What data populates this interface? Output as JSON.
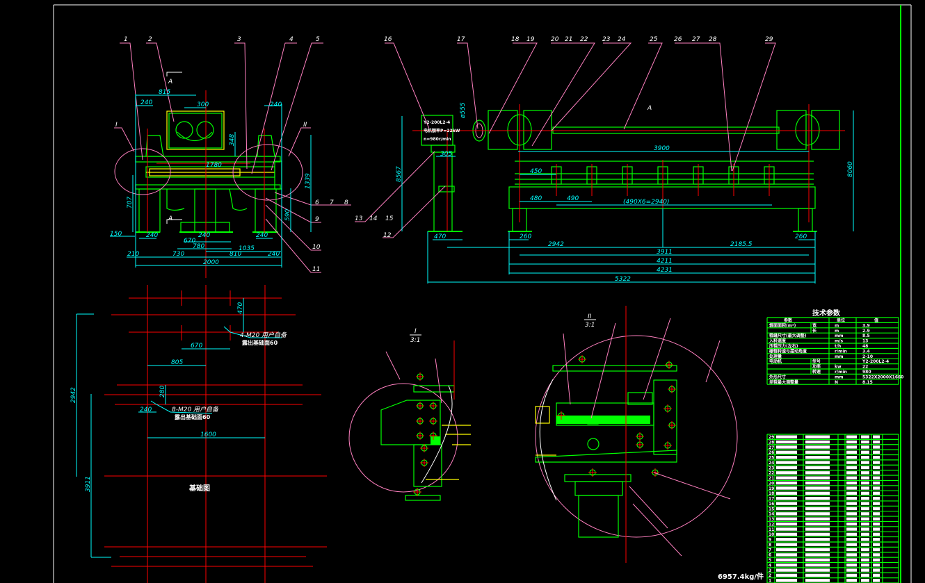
{
  "colors": {
    "background": "#000000",
    "outline": "#00ff00",
    "centerline": "#ff0000",
    "dimension": "#00ffff",
    "leader": "#ff80c0",
    "hidden": "#ffff00",
    "text": "#ffffff"
  },
  "front_view": {
    "part_numbers": [
      "1",
      "2",
      "3",
      "4",
      "5",
      "6",
      "7",
      "8",
      "9",
      "10",
      "11"
    ],
    "detail_markers": [
      "I",
      "II"
    ],
    "section_marks": [
      "A",
      "A"
    ],
    "dims": {
      "d815": "815",
      "d240a": "240",
      "d300": "300",
      "d240b": "240",
      "d348": "348",
      "d1780": "1780",
      "d1339": "1339",
      "d707": "707",
      "d590": "590",
      "d150": "150",
      "d240c": "240",
      "d670": "670",
      "d240d": "240",
      "d240e": "240",
      "d780": "780",
      "d1035": "1035",
      "d210": "210",
      "d730": "730",
      "d810": "810",
      "d240f": "240",
      "d2000": "2000"
    }
  },
  "side_view": {
    "part_numbers": [
      "12",
      "13",
      "14",
      "15",
      "16",
      "17",
      "18",
      "19",
      "20",
      "21",
      "22",
      "23",
      "24",
      "25",
      "26",
      "27",
      "28",
      "29"
    ],
    "section_label": "A",
    "motor_labels": [
      "Y2-200L2-4",
      "电机额率P=22kW",
      "n=980r/min"
    ],
    "dims": {
      "d3900": "3900",
      "d450": "450",
      "d480": "480",
      "d490": "490",
      "d490x6": "(490X6=2940)",
      "d8567": "8567",
      "d8060": "8060",
      "d555": "ø555",
      "d305": "305",
      "d470": "470",
      "d260a": "260",
      "d260b": "260",
      "d2942": "2942",
      "d2185": "2185.5",
      "d3911": "3911",
      "d4211": "4211",
      "d4231": "4231",
      "d5322": "5322"
    }
  },
  "foundation": {
    "title": "基础图",
    "note1a": "4-M20 用户自备",
    "note1b": "露出基础面60",
    "note2a": "8-M20 用户自备",
    "note2b": "露出基础面60",
    "dims": {
      "d470": "470",
      "d670": "670",
      "d805": "805",
      "d280": "280",
      "d240": "240",
      "d1600": "1600",
      "d2942": "2942",
      "d3911": "3911"
    }
  },
  "details": {
    "detail1_label": "I",
    "detail1_scale": "3:1",
    "detail2_label": "II",
    "detail2_scale": "3:1"
  },
  "tech_table": {
    "title": "技术参数",
    "headers": [
      "参数",
      "单位",
      "值"
    ],
    "rows": [
      {
        "param": "辊面面积(m²)",
        "sub": "宽",
        "unit": "m",
        "value": "3.9"
      },
      {
        "param": "",
        "sub": "长",
        "unit": "m",
        "value": "2.9"
      },
      {
        "param": "辊缝尺寸(最大调整)",
        "sub": "",
        "unit": "mm",
        "value": "8.5"
      },
      {
        "param": "入料速度",
        "sub": "",
        "unit": "m/s",
        "value": "13"
      },
      {
        "param": "压辊压力(左右)",
        "sub": "",
        "unit": "t/h",
        "value": "48"
      },
      {
        "param": "碾辊转速与摆动角度",
        "sub": "",
        "unit": "r/min",
        "value": "3.4"
      },
      {
        "param": "处理量",
        "sub": "",
        "unit": "mm",
        "value": "2-10"
      },
      {
        "param": "电动机",
        "sub": "型号",
        "unit": "",
        "value": "Y2-200L2-4"
      },
      {
        "param": "",
        "sub": "功率",
        "unit": "kw",
        "value": "22"
      },
      {
        "param": "",
        "sub": "转速",
        "unit": "r/min",
        "value": "980"
      },
      {
        "param": "外形尺寸",
        "sub": "",
        "unit": "mm",
        "value": "5322X2000X1660"
      },
      {
        "param": "单辊最大调整量",
        "sub": "",
        "unit": "N",
        "value": "8.15"
      }
    ]
  },
  "parts_list": {
    "numbers": [
      "29",
      "28",
      "27",
      "26",
      "25",
      "24",
      "23",
      "22",
      "21",
      "20",
      "19",
      "18",
      "17",
      "16",
      "15",
      "14",
      "13",
      "12",
      "11",
      "10",
      "9",
      "8",
      "7",
      "6",
      "5",
      "4",
      "3",
      "2",
      "1"
    ]
  },
  "weight": "6957.4kg/件"
}
